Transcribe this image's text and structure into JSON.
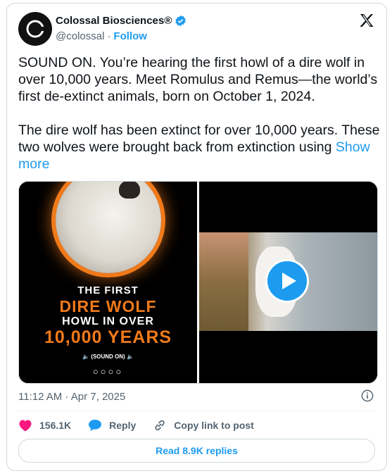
{
  "author": {
    "name": "Colossal Biosciences®",
    "handle": "@colossal",
    "follow_label": "Follow"
  },
  "tweet": {
    "text": "SOUND ON. You’re hearing the first howl of a dire wolf in over 10,000 years. Meet Romulus and Remus—the world’s first de-extinct animals, born on October 1, 2024.\n\nThe dire wolf has been extinct for over 10,000 years. These two wolves were brought back from extinction using ",
    "show_more": "Show more"
  },
  "media": {
    "left_lines": [
      "THE FIRST",
      "DIRE WOLF",
      "HOWL IN OVER",
      "10,000 YEARS",
      "🔈 (SOUND ON) 🔈",
      "○○○○"
    ]
  },
  "meta": {
    "timestamp": "11:12 AM · Apr 7, 2025"
  },
  "actions": {
    "likes": "156.1K",
    "reply_label": "Reply",
    "copy_label": "Copy link to post",
    "read_replies": "Read 8.9K replies"
  },
  "colors": {
    "accent": "#1d9bf0",
    "like": "#f91880",
    "orange": "#f07a1a"
  }
}
